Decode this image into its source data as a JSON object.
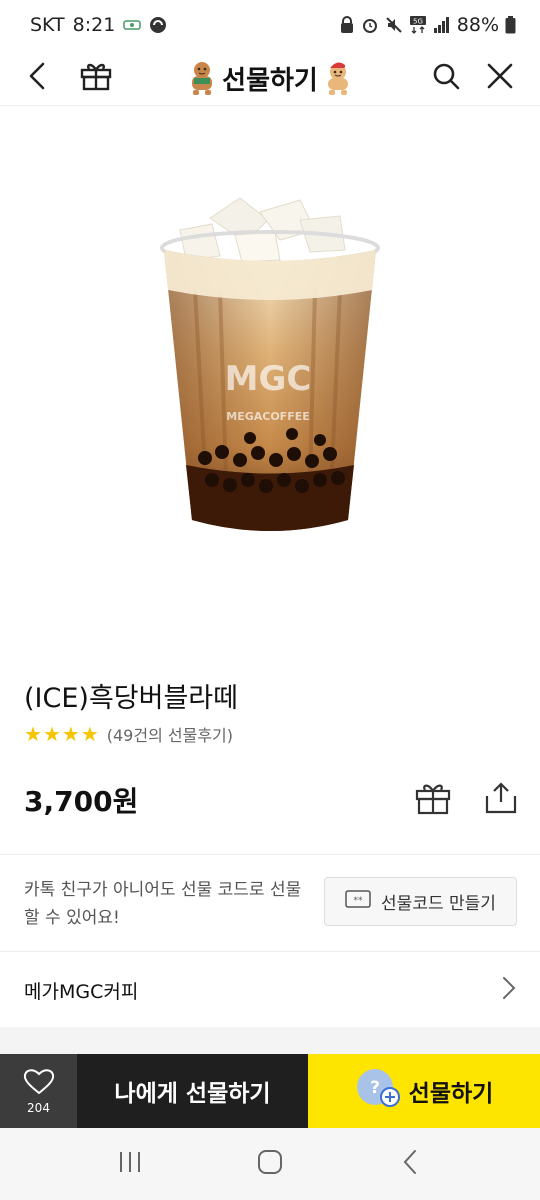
{
  "status_bar": {
    "carrier": "SKT",
    "time": "8:21",
    "network": "5G",
    "battery": "88%"
  },
  "header": {
    "title": "선물하기",
    "icons": [
      "back-icon",
      "gift-box-icon",
      "search-icon",
      "close-icon"
    ]
  },
  "product": {
    "image_icon": "bubble-tea-cup",
    "cup_logo_text": "MGC",
    "cup_brand_text": "MEGACOFFEE",
    "name": "(ICE)흑당버블라떼",
    "rating_stars": 4,
    "review_count": "(49건의 선물후기)",
    "price": "3,700원"
  },
  "gift_code": {
    "description": "카톡 친구가 아니어도 선물 코드로 선물 할 수 있어요!",
    "button_label": "선물코드 만들기"
  },
  "brand": {
    "name": "메가MGC커피"
  },
  "bottom_bar": {
    "wish_count": "204",
    "self_gift_label": "나에게 선물하기",
    "gift_label": "선물하기"
  },
  "colors": {
    "accent_yellow": "#fee500",
    "dark": "#1f1f1f",
    "star": "#f5c500"
  }
}
